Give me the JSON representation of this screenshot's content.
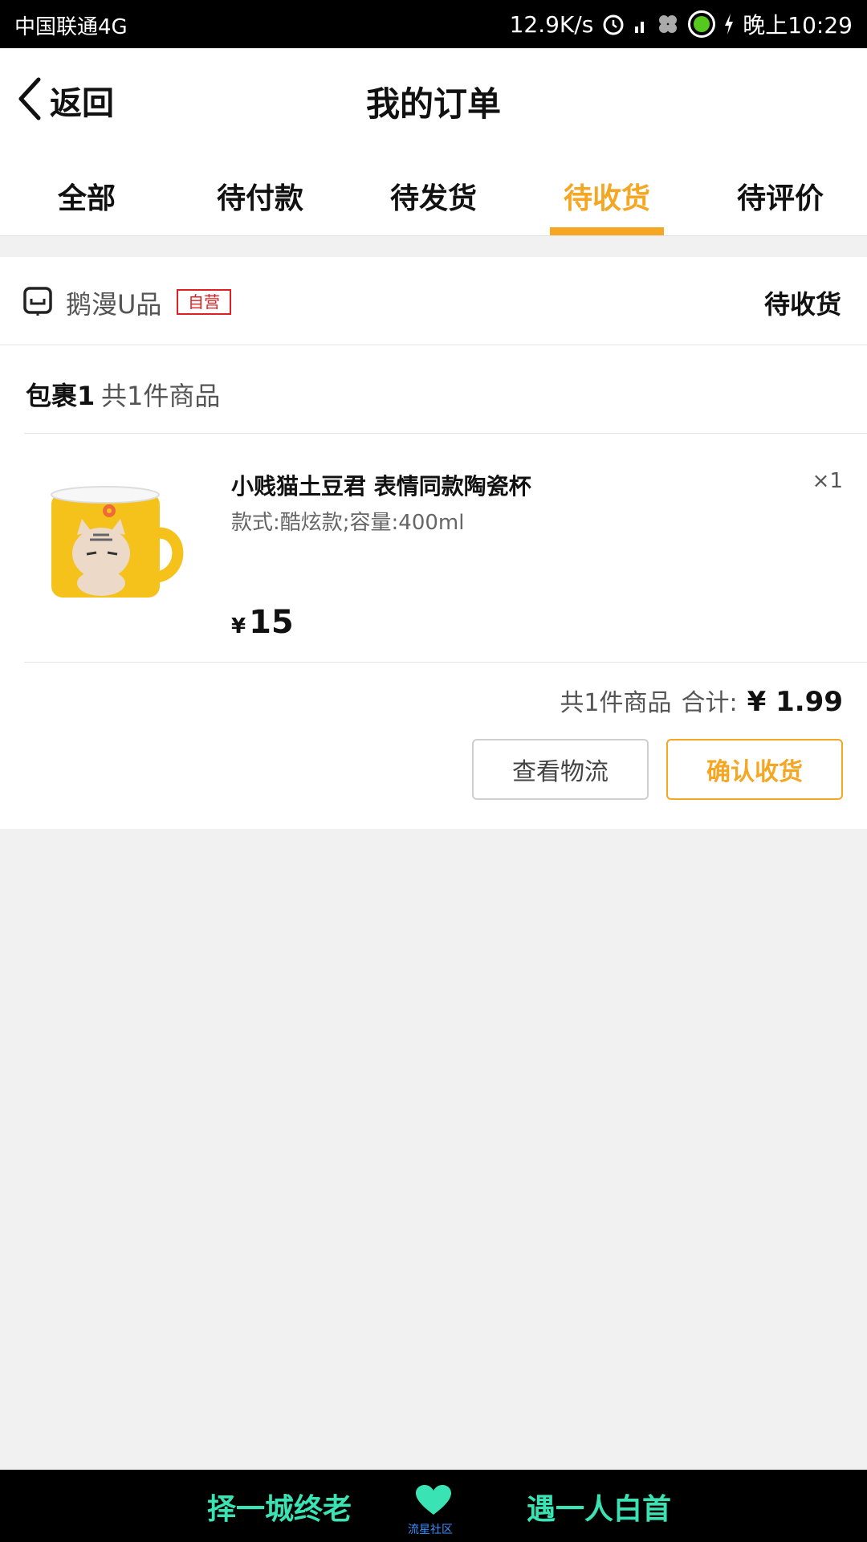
{
  "status_bar": {
    "carrier": "中国联通4G",
    "speed": "12.9K/s",
    "time": "晚上10:29",
    "icons": [
      "alarm-icon",
      "signal-icon",
      "clover-icon",
      "battery-icon",
      "charging-icon"
    ]
  },
  "nav": {
    "back_label": "返回",
    "title": "我的订单"
  },
  "tabs": [
    {
      "label": "全部",
      "active": false
    },
    {
      "label": "待付款",
      "active": false
    },
    {
      "label": "待发货",
      "active": false
    },
    {
      "label": "待收货",
      "active": true
    },
    {
      "label": "待评价",
      "active": false
    }
  ],
  "order": {
    "store_name": "鹅漫U品",
    "store_badge": "自营",
    "status": "待收货",
    "package_label": "包裹1",
    "package_count": "共1件商品",
    "item": {
      "title": "小贱猫土豆君 表情同款陶瓷杯",
      "spec": "款式:酷炫款;容量:400ml",
      "quantity": "×1",
      "price_symbol": "¥",
      "price": "15"
    },
    "summary_count": "共1件商品",
    "summary_label": "合计:",
    "summary_total": "¥ 1.99",
    "buttons": {
      "logistics": "查看物流",
      "confirm": "确认收货"
    }
  },
  "banner": {
    "left_text": "择一城终老",
    "right_text": "遇一人白首",
    "caption": "流星社区"
  },
  "colors": {
    "accent": "#f5a623",
    "badge_red": "#e02020",
    "banner_text": "#39e3b4"
  }
}
